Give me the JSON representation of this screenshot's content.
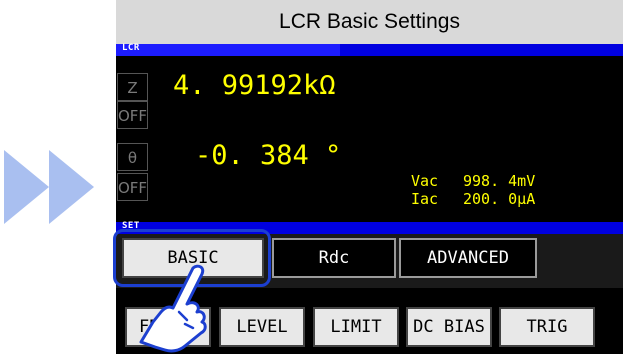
{
  "title": "LCR Basic Settings",
  "sections": {
    "lcr": "LCR",
    "set": "SET"
  },
  "side_buttons": {
    "z": "Z",
    "off1": "OFF",
    "theta": "θ",
    "off2": "OFF"
  },
  "measurements": {
    "z_value": "4. 99192kΩ",
    "theta_value": "-0. 384 °",
    "vac_label": "Vac",
    "vac_value": "998. 4mV",
    "iac_label": "Iac",
    "iac_value": "200. 0µA"
  },
  "tabs": [
    "BASIC",
    "Rdc",
    "ADVANCED"
  ],
  "function_buttons": [
    "FREQ",
    "LEVEL",
    "LIMIT",
    "DC BIAS",
    "TRIG"
  ],
  "icons": {
    "next": "double-play-arrow-icon",
    "hand": "pointing-hand-icon"
  },
  "colors": {
    "title_bg": "#d9d9d9",
    "section_bar": "#0000e0",
    "value_text": "#ffff00",
    "highlight": "#1c3fd0",
    "arrow": "#a9bff0"
  }
}
